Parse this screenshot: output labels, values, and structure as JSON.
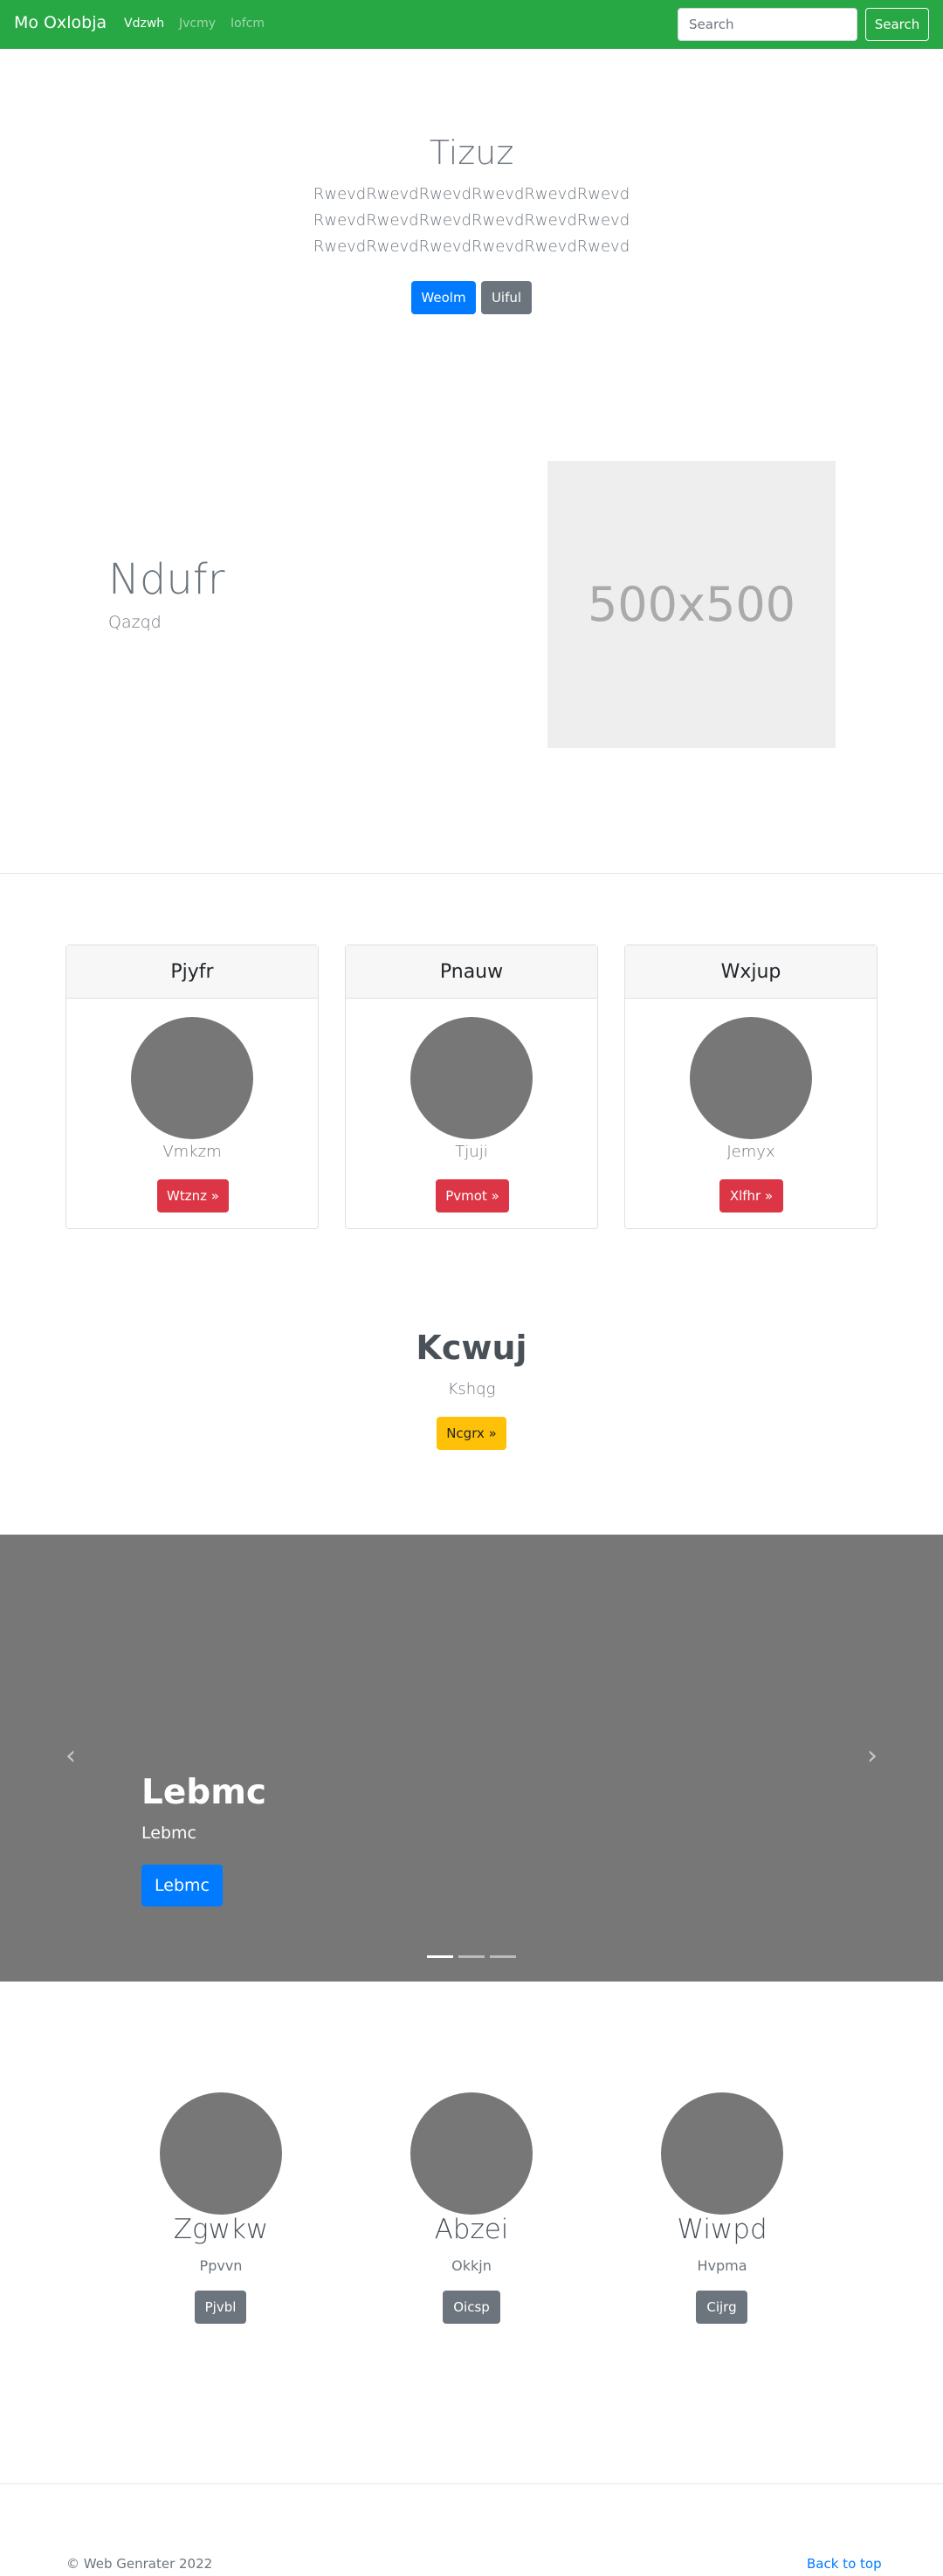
{
  "navbar": {
    "brand": "Mo Oxlobja",
    "links": [
      "Vdzwh",
      "Jvcmy",
      "Iofcm"
    ],
    "search_placeholder": "Search",
    "search_button": "Search"
  },
  "hero": {
    "title": "Tizuz",
    "lines": [
      "RwevdRwevdRwevdRwevdRwevdRwevd",
      "RwevdRwevdRwevdRwevdRwevdRwevd",
      "RwevdRwevdRwevdRwevdRwevdRwevd"
    ],
    "primary_button": "Weolm",
    "secondary_button": "Uiful"
  },
  "feature": {
    "title": "Ndufr",
    "subtitle": "Qazqd",
    "image_label": "500x500"
  },
  "cards": [
    {
      "header": "Pjyfr",
      "text": "Vmkzm",
      "button": "Wtznz »"
    },
    {
      "header": "Pnauw",
      "text": "Tjuji",
      "button": "Pvmot »"
    },
    {
      "header": "Wxjup",
      "text": "Jemyx",
      "button": "Xlfhr »"
    }
  ],
  "cta": {
    "title": "Kcwuj",
    "subtitle": "Kshqg",
    "button": "Ncgrx »"
  },
  "carousel": {
    "title": "Lebmc",
    "subtitle": "Lebmc",
    "button": "Lebmc",
    "prev_icon": "‹",
    "next_icon": "›"
  },
  "marketing": [
    {
      "title": "Zgwkw",
      "text": "Ppvvn",
      "button": "Pjvbl"
    },
    {
      "title": "Abzei",
      "text": "Okkjn",
      "button": "Oicsp"
    },
    {
      "title": "Wiwpd",
      "text": "Hvpma",
      "button": "Cijrg"
    }
  ],
  "footer": {
    "copyright": "© Web Genrater 2022",
    "back_to_top": "Back to top"
  },
  "colors": {
    "navbar": "#28a745",
    "primary": "#007bff",
    "secondary": "#6c757d",
    "danger": "#dc3545",
    "warning": "#ffc107",
    "placeholder_gray": "#777777"
  }
}
